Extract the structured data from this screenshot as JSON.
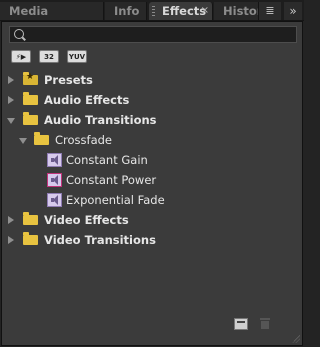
{
  "tabs": [
    {
      "label": "Media Browser"
    },
    {
      "label": "Info"
    },
    {
      "label": "Effects",
      "active": true
    },
    {
      "label": "History"
    }
  ],
  "tab_close_glyph": "×",
  "menu_glyph": "≣",
  "overflow_glyph": "»",
  "search": {
    "value": "",
    "placeholder": ""
  },
  "filters": [
    {
      "label": "⚡▶",
      "icon": "accelerated-effects-icon"
    },
    {
      "label": "32",
      "icon": "32-bit-effects-icon"
    },
    {
      "label": "YUV",
      "icon": "yuv-effects-icon"
    }
  ],
  "tree": [
    {
      "label": "Presets",
      "state": "collapsed",
      "kind": "presets-folder"
    },
    {
      "label": "Audio Effects",
      "state": "collapsed",
      "kind": "folder"
    },
    {
      "label": "Audio Transitions",
      "state": "expanded",
      "kind": "folder"
    },
    {
      "label": "Crossfade",
      "state": "expanded",
      "kind": "folder"
    },
    {
      "label": "Constant Gain",
      "kind": "audio-transition"
    },
    {
      "label": "Constant Power",
      "kind": "audio-transition",
      "default": true
    },
    {
      "label": "Exponential Fade",
      "kind": "audio-transition"
    },
    {
      "label": "Video Effects",
      "state": "collapsed",
      "kind": "folder"
    },
    {
      "label": "Video Transitions",
      "state": "collapsed",
      "kind": "folder"
    }
  ],
  "colors": {
    "folder": "#e8c340",
    "panel": "#3b3b3b",
    "default_marker": "#c1337a"
  }
}
